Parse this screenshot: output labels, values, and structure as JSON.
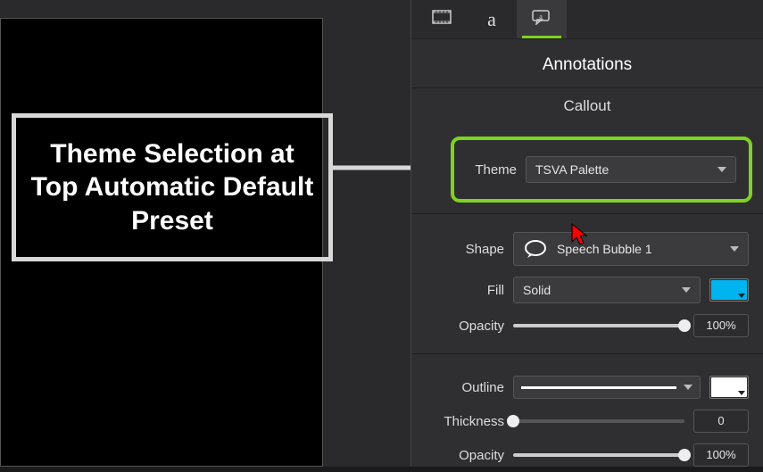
{
  "canvas": {
    "callout_text": "Theme Selection at Top Automatic Default Preset"
  },
  "tabs": {
    "media_icon": "media-icon",
    "text_letter": "a",
    "annotations_icon": "annotation-callout-icon"
  },
  "panel": {
    "title": "Annotations",
    "section": "Callout",
    "theme_label": "Theme",
    "theme_value": "TSVA Palette",
    "shape_label": "Shape",
    "shape_value": "Speech Bubble 1",
    "fill_label": "Fill",
    "fill_value": "Solid",
    "fill_color": "#00b4ef",
    "fill_opacity_label": "Opacity",
    "fill_opacity_value": "100%",
    "fill_opacity_pct": 100,
    "outline_label": "Outline",
    "outline_color": "#ffffff",
    "thickness_label": "Thickness",
    "thickness_value": "0",
    "thickness_pct": 0,
    "outline_opacity_label": "Opacity",
    "outline_opacity_value": "100%",
    "outline_opacity_pct": 100
  }
}
